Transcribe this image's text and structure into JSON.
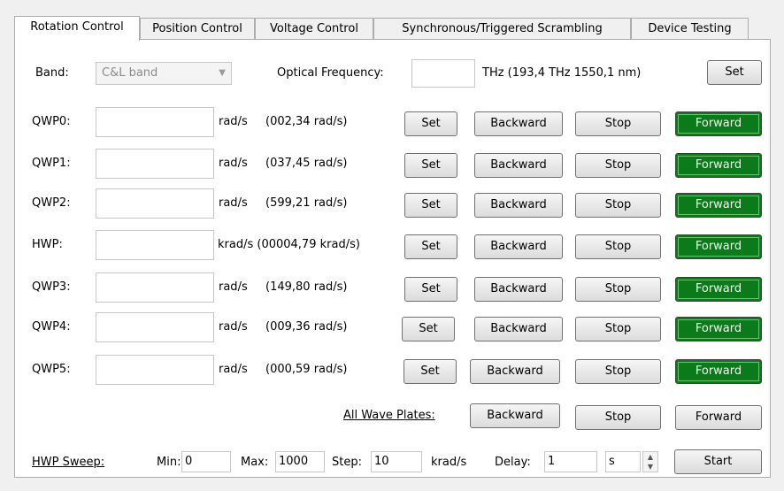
{
  "tabs": [
    {
      "label": "Rotation Control"
    },
    {
      "label": "Position Control"
    },
    {
      "label": "Voltage Control"
    },
    {
      "label": "Synchronous/Triggered Scrambling"
    },
    {
      "label": "Device Testing"
    }
  ],
  "band": {
    "label": "Band:",
    "value": "C&L band"
  },
  "frequency": {
    "label": "Optical Frequency:",
    "value": "",
    "unit_info": "THz (193,4 THz  1550,1 nm)",
    "set_label": "Set"
  },
  "plates": [
    {
      "name": "QWP0:",
      "value": "",
      "unit": "rad/s",
      "current": "(002,34 rad/s)"
    },
    {
      "name": "QWP1:",
      "value": "",
      "unit": "rad/s",
      "current": "(037,45 rad/s)"
    },
    {
      "name": "QWP2:",
      "value": "",
      "unit": "rad/s",
      "current": "(599,21 rad/s)"
    },
    {
      "name": "HWP:",
      "value": "",
      "unit": "krad/s",
      "current": "(00004,79 krad/s)"
    },
    {
      "name": "QWP3:",
      "value": "",
      "unit": "rad/s",
      "current": "(149,80 rad/s)"
    },
    {
      "name": "QWP4:",
      "value": "",
      "unit": "rad/s",
      "current": "(009,36 rad/s)"
    },
    {
      "name": "QWP5:",
      "value": "",
      "unit": "rad/s",
      "current": "(000,59 rad/s)"
    }
  ],
  "buttons": {
    "set": "Set",
    "backward": "Backward",
    "stop": "Stop",
    "forward": "Forward"
  },
  "all_plates": {
    "label": "All Wave Plates:",
    "backward": "Backward",
    "stop": "Stop",
    "forward": "Forward"
  },
  "sweep": {
    "label": "HWP Sweep:",
    "min_label": "Min:",
    "min_value": "0",
    "max_label": "Max:",
    "max_value": "1000",
    "step_label": "Step:",
    "step_value": "10",
    "unit": "krad/s",
    "delay_label": "Delay:",
    "delay_value": "1",
    "delay_unit": "s",
    "start_label": "Start"
  },
  "colors": {
    "forward_active": "#0b7a1a"
  }
}
